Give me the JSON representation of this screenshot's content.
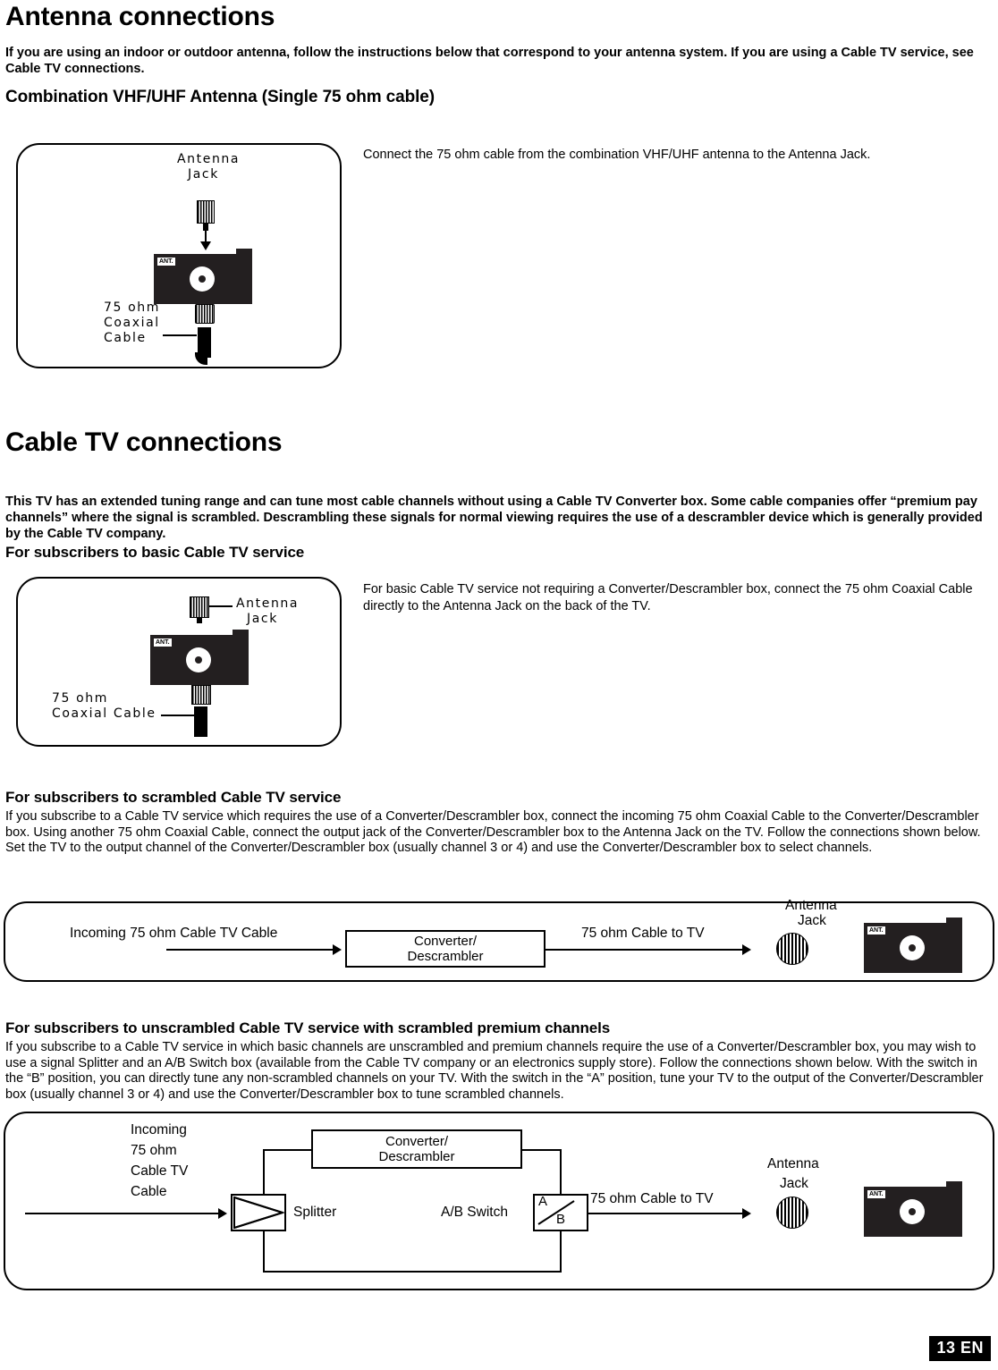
{
  "sections": {
    "antenna": {
      "title": "Antenna connections",
      "intro": "If you are using an indoor or outdoor antenna, follow the instructions below that correspond to your antenna system. If you are using a Cable TV service, see Cable TV connections.",
      "subhead": "Combination VHF/UHF Antenna (Single 75 ohm cable)",
      "side_text": "Connect the 75 ohm cable from the combination VHF/UHF antenna to the Antenna Jack.",
      "diagram": {
        "antenna_jack_line1": "Antenna",
        "antenna_jack_line2": "Jack",
        "cable_line1": "75 ohm",
        "cable_line2": "Coaxial",
        "cable_line3": "Cable",
        "ant_label": "ANT."
      }
    },
    "cable": {
      "title": "Cable TV connections",
      "intro": "This TV has an extended tuning range and can tune most cable channels without using a Cable TV Converter box. Some cable companies offer “premium pay channels” where the signal is scrambled. Descrambling these signals for normal viewing requires the use of a descrambler device which is generally provided by the Cable TV company.",
      "basic": {
        "subhead": "For subscribers to basic Cable TV service",
        "side_text": "For basic Cable TV service not requiring a Converter/Descrambler box, connect the 75 ohm Coaxial Cable directly to the Antenna Jack on the back of the TV.",
        "diagram": {
          "antenna_jack_line1": "Antenna",
          "antenna_jack_line2": "Jack",
          "cable_line1": "75 ohm",
          "cable_line2": "Coaxial Cable",
          "ant_label": "ANT."
        }
      },
      "scrambled": {
        "subhead": "For subscribers to scrambled Cable TV service",
        "body": "If you subscribe to a Cable TV service which requires the use of a Converter/Descrambler box, connect the incoming 75 ohm Coaxial Cable to the Converter/Descrambler box. Using another 75 ohm Coaxial Cable, connect the output jack of the Converter/Descrambler box to the Antenna Jack on the TV. Follow the connections shown below. Set the TV to the output channel of the Converter/Descrambler box (usually channel 3 or 4) and use the Converter/Descrambler box to select channels.",
        "diagram": {
          "incoming_label": "Incoming 75 ohm Cable TV Cable",
          "converter_line1": "Converter/",
          "converter_line2": "Descrambler",
          "out_label": "75 ohm Cable to TV",
          "antenna_jack_line1": "Antenna",
          "antenna_jack_line2": "Jack",
          "ant_label": "ANT."
        }
      },
      "premium": {
        "subhead": "For subscribers to unscrambled Cable TV service with scrambled premium channels",
        "body": "If you subscribe to a Cable TV service in which basic channels are unscrambled and premium channels require the use of a Converter/Descrambler box, you may wish to use a signal Splitter and an A/B Switch box (available from the Cable TV company or an electronics supply store). Follow the connections shown below. With the switch in the “B” position, you can directly tune any non-scrambled channels on your TV. With the switch in the “A” position, tune your TV to the output of the Converter/Descrambler box (usually channel 3 or 4) and use the Converter/Descrambler box to tune scrambled channels.",
        "diagram": {
          "incoming_line1": "Incoming",
          "incoming_line2": "75 ohm",
          "incoming_line3": "Cable TV",
          "incoming_line4": "Cable",
          "converter_line1": "Converter/",
          "converter_line2": "Descrambler",
          "splitter_label": "Splitter",
          "ab_switch_label": "A/B Switch",
          "switch_a": "A",
          "switch_b": "B",
          "out_label": "75 ohm Cable to TV",
          "antenna_jack_line1": "Antenna",
          "antenna_jack_line2": "Jack",
          "ant_label": "ANT."
        }
      }
    }
  },
  "footer": {
    "page_number": "13 EN"
  }
}
